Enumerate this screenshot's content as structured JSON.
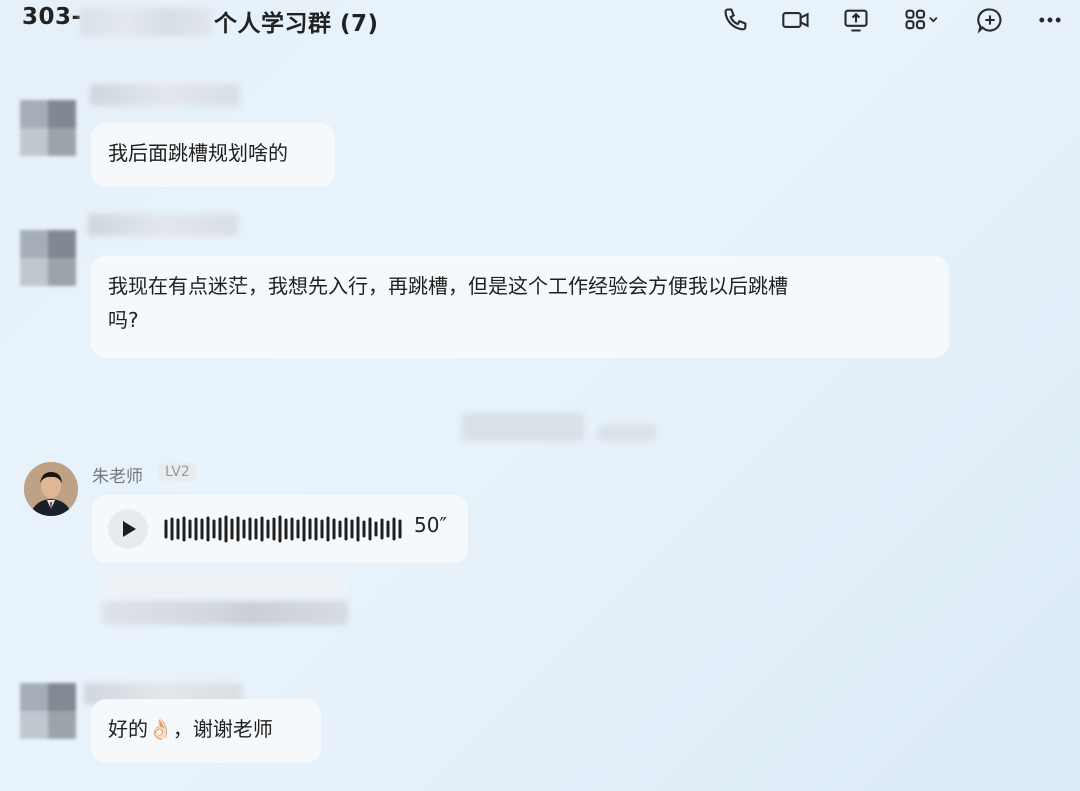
{
  "header": {
    "title_prefix": "303-",
    "title_suffix": "个人学习群 (7)",
    "icons": [
      "phone-icon",
      "video-icon",
      "screen-share-icon",
      "apps-grid-icon",
      "add-icon",
      "more-icon"
    ]
  },
  "messages": [
    {
      "text": "我后面跳槽规划啥的"
    },
    {
      "text_line1": "我现在有点迷茫，我想先入行，再跳槽，但是这个工作经验会方便我以后跳槽",
      "text_line2": "吗?"
    },
    {
      "sender": "朱老师",
      "level": "LV2",
      "voice_duration": "50″"
    },
    {
      "text_before": "好的",
      "emoji": "👌🏻",
      "text_after": "，谢谢老师"
    }
  ],
  "colors": {
    "background": "#e6f0f8",
    "bubble": "#f6f9fc"
  }
}
